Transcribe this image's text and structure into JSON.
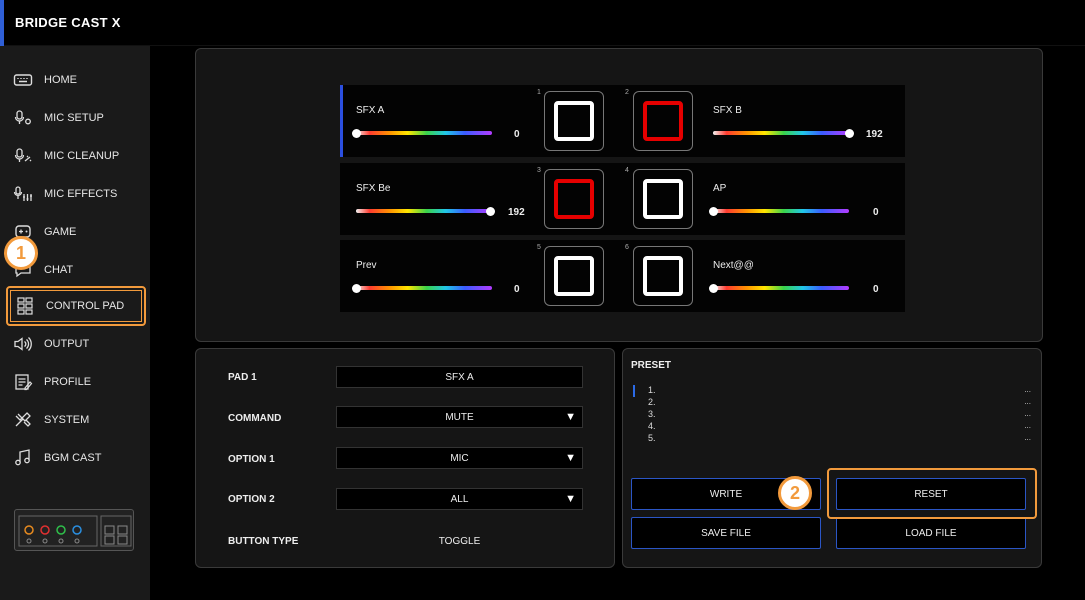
{
  "app": {
    "title": "BRIDGE CAST X"
  },
  "sidebar": {
    "items": [
      {
        "label": "HOME",
        "icon": "keyboard-icon"
      },
      {
        "label": "MIC SETUP",
        "icon": "mic-gear-icon"
      },
      {
        "label": "MIC CLEANUP",
        "icon": "mic-sparkle-icon"
      },
      {
        "label": "MIC EFFECTS",
        "icon": "mic-sliders-icon"
      },
      {
        "label": "GAME",
        "icon": "gamepad-icon"
      },
      {
        "label": "CHAT",
        "icon": "chat-icon"
      },
      {
        "label": "CONTROL PAD",
        "icon": "grid-icon",
        "active": true
      },
      {
        "label": "OUTPUT",
        "icon": "speaker-icon"
      },
      {
        "label": "PROFILE",
        "icon": "profile-icon"
      },
      {
        "label": "SYSTEM",
        "icon": "tools-icon"
      },
      {
        "label": "BGM CAST",
        "icon": "music-note-icon"
      }
    ]
  },
  "pads": [
    {
      "num": "1",
      "name": "SFX A",
      "value": "0",
      "level": 0,
      "button": "white",
      "selected": true
    },
    {
      "num": "2",
      "name": "SFX B",
      "value": "192",
      "level": 1,
      "button": "red"
    },
    {
      "num": "3",
      "name": "SFX Be",
      "value": "192",
      "level": 1,
      "button": "red"
    },
    {
      "num": "4",
      "name": "AP",
      "value": "0",
      "level": 0,
      "button": "white"
    },
    {
      "num": "5",
      "name": "Prev",
      "value": "0",
      "level": 0,
      "button": "white"
    },
    {
      "num": "6",
      "name": "Next@@",
      "value": "0",
      "level": 0,
      "button": "white"
    }
  ],
  "settings": {
    "pad_label": "PAD 1",
    "pad_value": "SFX A",
    "command_label": "COMMAND",
    "command_value": "MUTE",
    "option1_label": "OPTION 1",
    "option1_value": "MIC",
    "option2_label": "OPTION 2",
    "option2_value": "ALL",
    "button_type_label": "BUTTON TYPE",
    "button_type_value": "TOGGLE",
    "dropdown_arrow": "▼"
  },
  "preset": {
    "title": "PRESET",
    "items": [
      {
        "num": "1.",
        "dots": "..."
      },
      {
        "num": "2.",
        "dots": "..."
      },
      {
        "num": "3.",
        "dots": "..."
      },
      {
        "num": "4.",
        "dots": "..."
      },
      {
        "num": "5.",
        "dots": "..."
      }
    ],
    "write_label": "WRITE",
    "reset_label": "RESET",
    "save_label": "SAVE FILE",
    "load_label": "LOAD FILE"
  },
  "callouts": {
    "one": "1",
    "two": "2"
  },
  "colors": {
    "accent": "#f29a3c",
    "selection": "#2b4fe0",
    "pad_red": "#e60000"
  }
}
